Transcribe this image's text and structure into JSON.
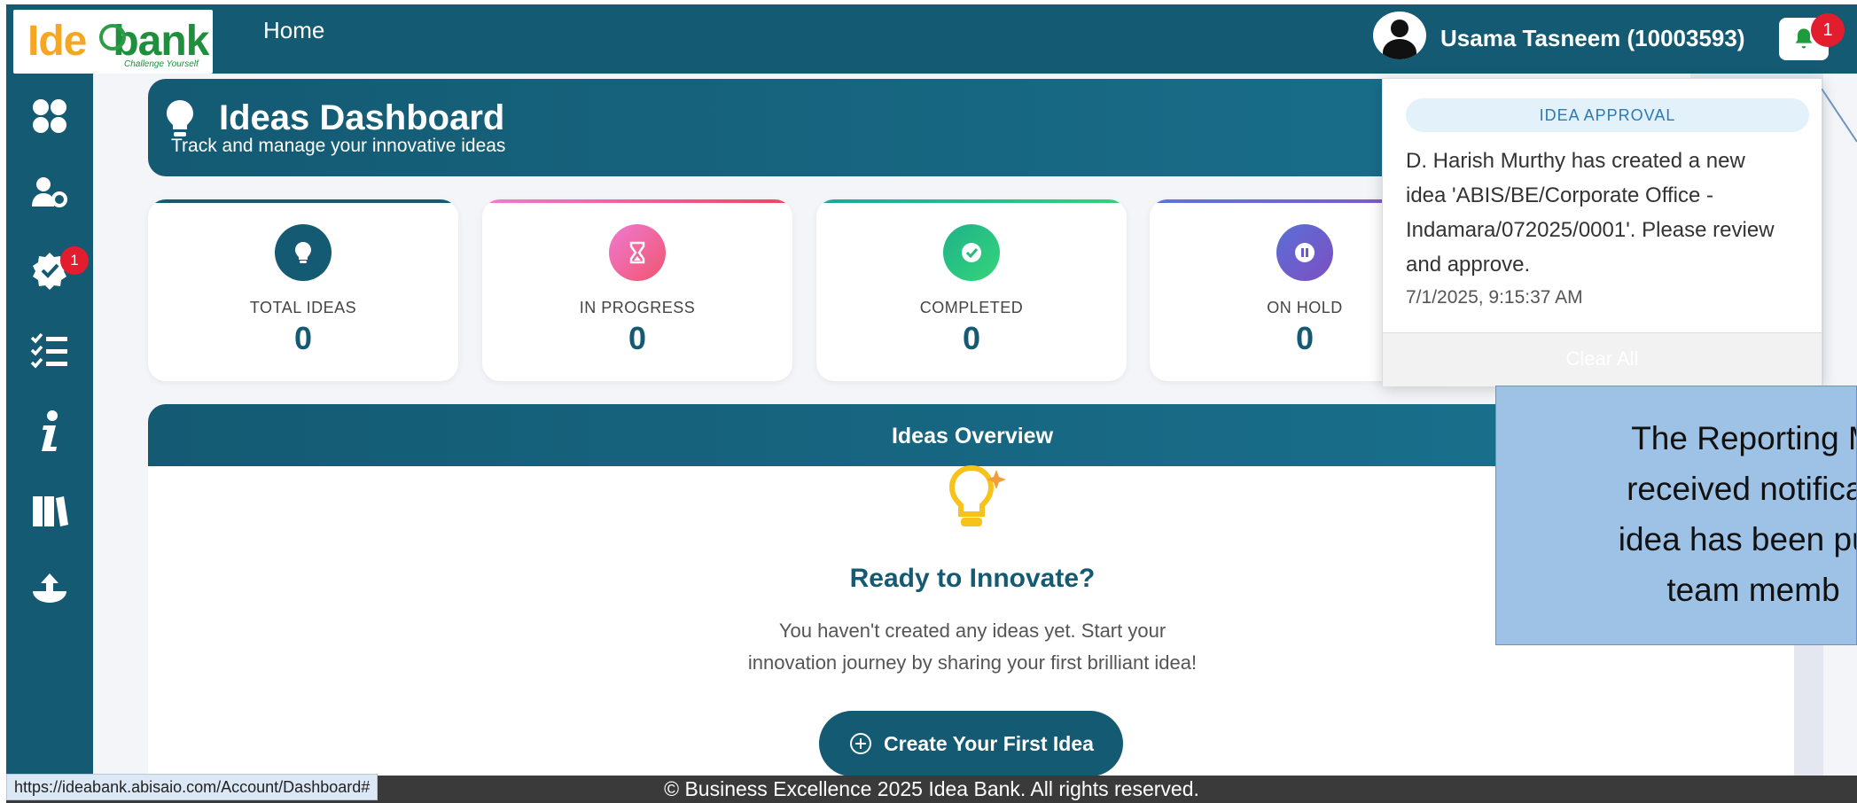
{
  "navbar": {
    "logo_text_ide": "Ide",
    "logo_text_bank": "bank",
    "logo_tagline": "Challenge Yourself",
    "home_label": "Home",
    "user_name": "Usama Tasneem (10003593)",
    "notification_count": "1"
  },
  "sidebar": {
    "items": [
      {
        "icon": "dashboard-grid-icon"
      },
      {
        "icon": "user-settings-icon"
      },
      {
        "icon": "verified-badge-icon",
        "badge": "1"
      },
      {
        "icon": "task-list-icon"
      },
      {
        "icon": "info-icon"
      },
      {
        "icon": "library-icon"
      },
      {
        "icon": "upload-icon"
      }
    ]
  },
  "dashboard": {
    "title": "Ideas Dashboard",
    "subtitle": "Track and manage your innovative ideas"
  },
  "stats": [
    {
      "label": "TOTAL IDEAS",
      "value": "0",
      "color": "#145a73",
      "icon": "lightbulb-icon"
    },
    {
      "label": "IN PROGRESS",
      "value": "0",
      "color": "#ec5c93",
      "icon": "hourglass-icon"
    },
    {
      "label": "COMPLETED",
      "value": "0",
      "color": "#2fc77a",
      "icon": "check-circle-icon"
    },
    {
      "label": "ON HOLD",
      "value": "0",
      "color": "#6a5bc9",
      "icon": "pause-icon"
    }
  ],
  "overview": {
    "title": "Ideas Overview",
    "ready_title": "Ready to Innovate?",
    "ready_line1": "You haven't created any ideas yet. Start your",
    "ready_line2": "innovation journey by sharing your first brilliant idea!",
    "create_button": "Create Your First Idea"
  },
  "notification": {
    "category": "IDEA APPROVAL",
    "message_line1": "D. Harish Murthy has created a new",
    "message_line2": "idea 'ABIS/BE/Corporate Office -",
    "message_line3": "Indamara/072025/0001'. Please review",
    "message_line4": "and approve.",
    "timestamp": "7/1/2025, 9:15:37 AM",
    "clear_all": "Clear All"
  },
  "callout": {
    "line1": "The Reporting M",
    "line2": "received notificati",
    "line3": "idea has been pub",
    "line4": "team memb"
  },
  "footer": {
    "copyright": "© Business Excellence 2025 Idea Bank. All rights reserved.",
    "status_url": "https://ideabank.abisaio.com/Account/Dashboard#"
  },
  "colors": {
    "primary": "#145a73",
    "badge_red": "#e11d2e",
    "callout_bg": "#9dc2e6"
  }
}
